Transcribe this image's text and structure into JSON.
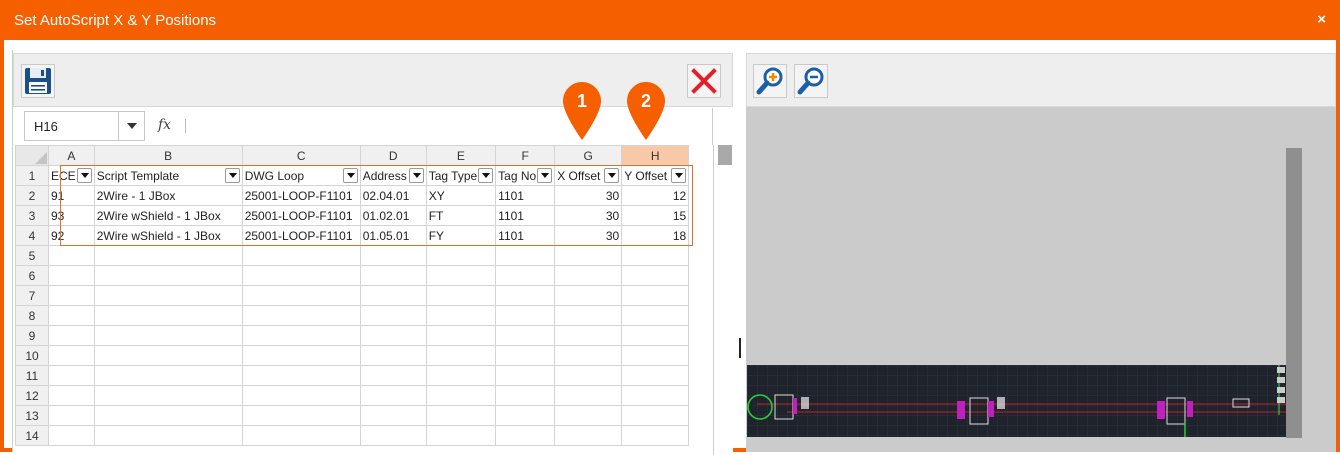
{
  "window": {
    "title": "Set AutoScript X & Y Positions",
    "close_glyph": "×"
  },
  "toolbar": {
    "save_icon": "floppy-disk-icon",
    "cancel_icon": "red-x-icon"
  },
  "formula_bar": {
    "cell_ref": "H16",
    "fx_label": "fx",
    "formula": ""
  },
  "sheet": {
    "column_letters": [
      "A",
      "B",
      "C",
      "D",
      "E",
      "F",
      "G",
      "H"
    ],
    "selected_column": "H",
    "row_numbers": [
      "1",
      "2",
      "3",
      "4",
      "5",
      "6",
      "7",
      "8",
      "9",
      "10",
      "11",
      "12",
      "13",
      "14"
    ],
    "headers": [
      "ECE",
      "Script Template",
      "DWG Loop",
      "Address",
      "Tag Type",
      "Tag No",
      "X Offset",
      "Y Offset"
    ],
    "rows": [
      [
        "91",
        "2Wire - 1 JBox",
        "25001-LOOP-F1101",
        "02.04.01",
        "XY",
        "1101",
        "30",
        "12"
      ],
      [
        "93",
        "2Wire wShield - 1 JBox",
        "25001-LOOP-F1101",
        "01.02.01",
        "FT",
        "1101",
        "30",
        "15"
      ],
      [
        "92",
        "2Wire wShield - 1 JBox",
        "25001-LOOP-F1101",
        "01.05.01",
        "FY",
        "1101",
        "30",
        "18"
      ]
    ]
  },
  "markers": [
    {
      "label": "1",
      "points_to": "X Offset",
      "color": "#f55f00"
    },
    {
      "label": "2",
      "points_to": "Y Offset",
      "color": "#f55f00"
    }
  ],
  "preview": {
    "zoom_in_icon": "zoom-in-icon",
    "zoom_out_icon": "zoom-out-icon"
  },
  "colors": {
    "accent": "#f55f00",
    "selected_header": "#f7c9a8",
    "range_outline": "#d8742e"
  }
}
